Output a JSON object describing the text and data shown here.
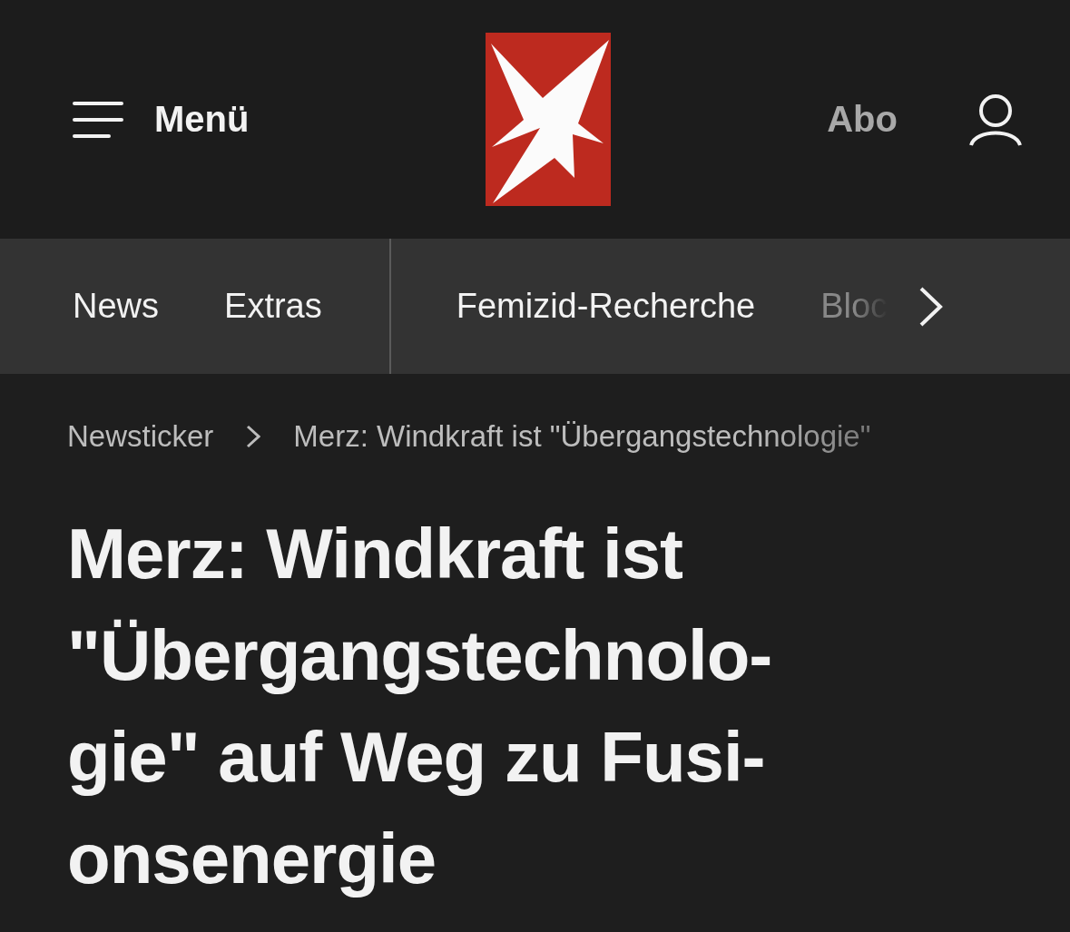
{
  "header": {
    "menu_label": "Menü",
    "abo_label": "Abo"
  },
  "nav": {
    "groups": [
      {
        "items": [
          {
            "label": "News",
            "faded": false
          },
          {
            "label": "Extras",
            "faded": false
          }
        ]
      },
      {
        "items": [
          {
            "label": "Femizid-Recherche",
            "faded": false
          },
          {
            "label": "Bloc",
            "faded": true
          }
        ]
      }
    ]
  },
  "breadcrumb": [
    {
      "label": "Newsticker"
    },
    {
      "label": "Merz: Windkraft ist \"Übergangstechnologie\""
    }
  ],
  "headline_lines": [
    "Merz: Windkraft ist",
    "\"Übergangstechnolo-",
    "gie\" auf Weg zu Fusi-",
    "onsenergie"
  ]
}
